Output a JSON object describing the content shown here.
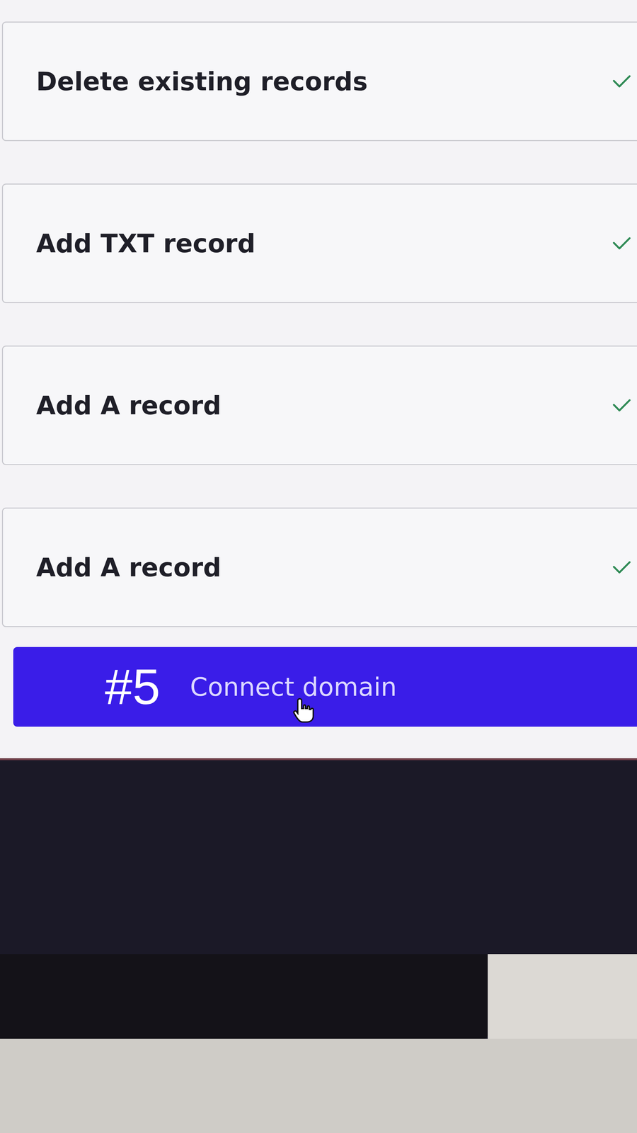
{
  "steps": [
    {
      "label": "Delete existing records",
      "done": true
    },
    {
      "label": "Add TXT record",
      "done": true
    },
    {
      "label": "Add A record",
      "done": true
    },
    {
      "label": "Add A record",
      "done": true
    }
  ],
  "annotation": "#5",
  "button": {
    "label": "Connect domain"
  }
}
